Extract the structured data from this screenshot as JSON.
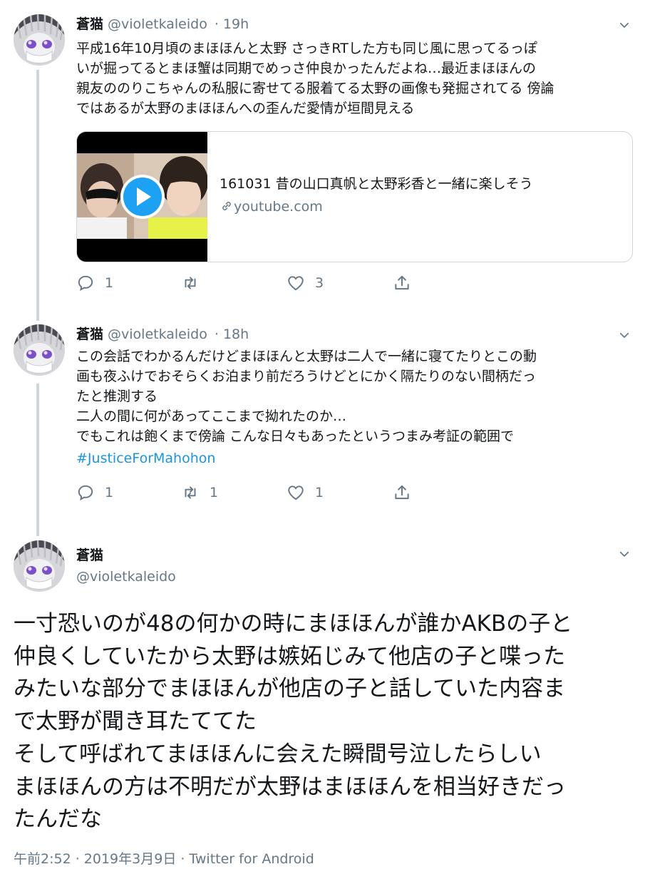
{
  "tweets": [
    {
      "name": "蒼猫",
      "handle": "@violetkaleido",
      "time": "· 19h",
      "lines": [
        "平成16年10月頃のまほほんと太野 さっきRTした方も同じ風に思ってるっぽ",
        "いが掘ってるとまほ蟹は同期でめっさ仲良かったんだよね…最近まほほんの",
        "親友ののりこちゃんの私服に寄せてる服着てる太野の画像も発掘されてる 傍論",
        "ではあるが太野のまほほんへの歪んだ愛情が垣間見える"
      ],
      "card": {
        "title": "161031 昔の山口真帆と太野彩香と一緒に楽しそう",
        "domain": "youtube.com"
      },
      "actions": {
        "reply": "1",
        "retweet": "",
        "like": "3"
      }
    },
    {
      "name": "蒼猫",
      "handle": "@violetkaleido",
      "time": "· 18h",
      "lines": [
        "この会話でわかるんだけどまほほんと太野は二人で一緒に寝てたりとこの動",
        "画も夜ふけでおそらくお泊まり前だろうけどとにかく隔たりのない間柄だっ",
        "たと推測する",
        "二人の間に何があってここまで拗れたのか…",
        "でもこれは飽くまで傍論 こんな日々もあったというつまみ考証の範囲で"
      ],
      "hashtag": "#JusticeForMahohon",
      "actions": {
        "reply": "1",
        "retweet": "1",
        "like": "1"
      }
    }
  ],
  "main_tweet": {
    "name": "蒼猫",
    "handle": "@violetkaleido",
    "lines": [
      "一寸恐いのが48の何かの時にまほほんが誰かAKBの子と",
      "仲良くしていたから太野は嫉妬じみて他店の子と喋った",
      "みたいな部分でまほほんが他店の子と話していた内容ま",
      "で太野が聞き耳たててた",
      "そして呼ばれてまほほんに会えた瞬間号泣したらしい",
      "まほほんの方は不明だが太野はまほほんを相当好きだっ",
      "たんだな"
    ],
    "meta": "午前2:52 · 2019年3月9日 · Twitter for Android"
  },
  "colors": {
    "accent": "#1b95e0",
    "play_button": "#1da1f2",
    "secondary_text": "#657786",
    "thread_line": "#ccd6dd"
  }
}
